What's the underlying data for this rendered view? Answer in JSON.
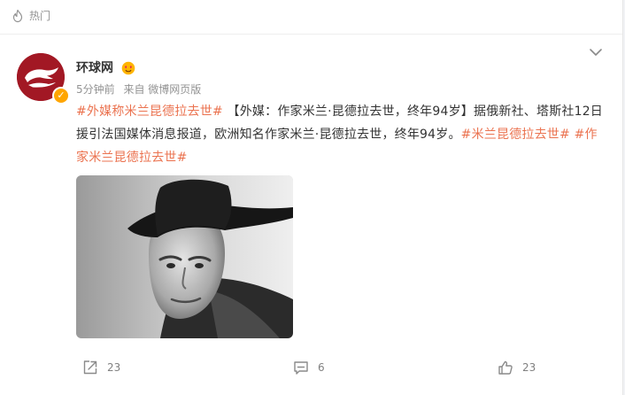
{
  "header": {
    "hot_label": "热门"
  },
  "post": {
    "author": "环球网",
    "time": "5分钟前",
    "source": "来自 微博网页版",
    "segments": [
      {
        "type": "tag",
        "text": "#外媒称米兰昆德拉去世#"
      },
      {
        "type": "text",
        "text": " 【外媒：作家米兰·昆德拉去世，终年94岁】据俄新社、塔斯社12日援引法国媒体消息报道，欧洲知名作家米兰·昆德拉去世，终年94岁。"
      },
      {
        "type": "tag",
        "text": "#米兰昆德拉去世#"
      },
      {
        "type": "text",
        "text": " "
      },
      {
        "type": "tag",
        "text": "#作家米兰昆德拉去世#"
      }
    ]
  },
  "actions": {
    "repost_count": "23",
    "comment_count": "6",
    "like_count": "23"
  },
  "colors": {
    "tag": "#eb7350",
    "avatar": "#a21824",
    "muted": "#939393"
  },
  "icons": [
    "fire-icon",
    "chevron-down-icon",
    "verified-icon",
    "emoji-badge-icon",
    "repost-icon",
    "comment-icon",
    "like-icon"
  ]
}
